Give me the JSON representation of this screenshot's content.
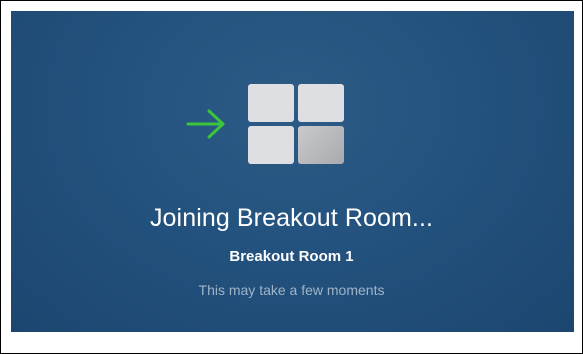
{
  "dialog": {
    "title": "Joining Breakout Room...",
    "room_name": "Breakout Room 1",
    "note": "This may take a few moments"
  },
  "icons": {
    "arrow": "arrow-right-icon",
    "arrow_color": "#3cc43c",
    "rooms": "breakout-rooms-grid-icon"
  },
  "colors": {
    "background": "#23527e",
    "title": "#ffffff",
    "note": "#9fb4c9"
  }
}
